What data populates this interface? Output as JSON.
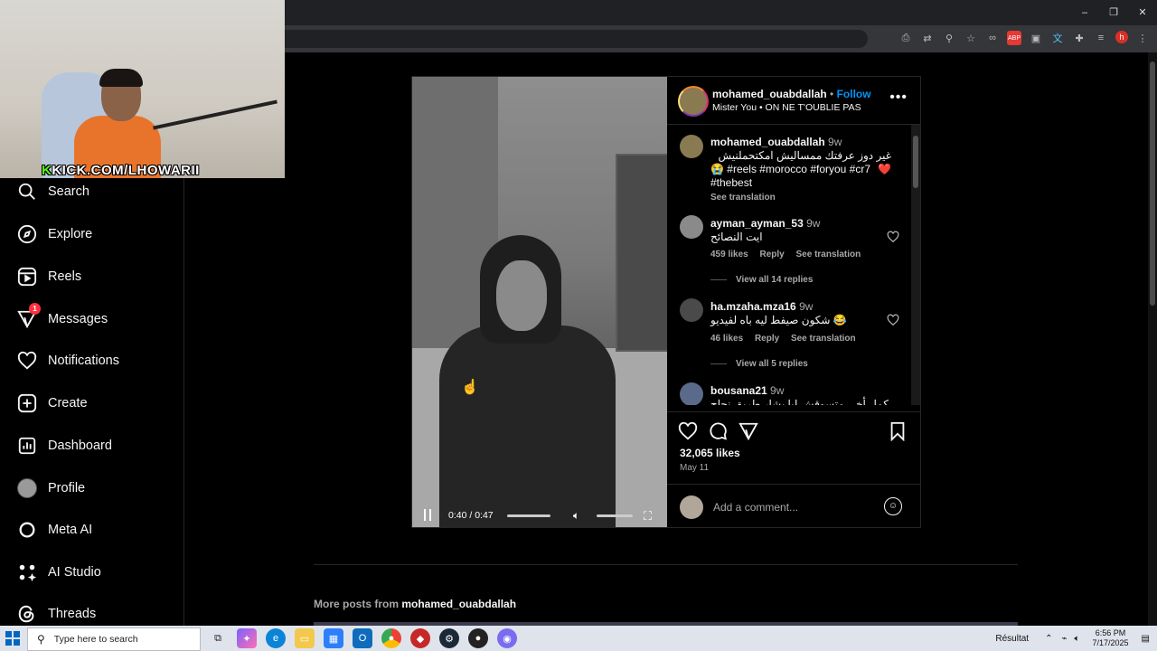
{
  "window": {
    "minimize": "–",
    "restore": "❐",
    "close": "✕"
  },
  "toolbar": {
    "profile_initial": "h"
  },
  "webcam": {
    "overlay_brand": "K",
    "overlay_text": "KICK.COM/LHOWARII"
  },
  "sidebar": {
    "items": [
      {
        "label": "Search"
      },
      {
        "label": "Explore"
      },
      {
        "label": "Reels"
      },
      {
        "label": "Messages",
        "badge": "1"
      },
      {
        "label": "Notifications"
      },
      {
        "label": "Create"
      },
      {
        "label": "Dashboard"
      },
      {
        "label": "Profile"
      },
      {
        "label": "Meta AI"
      },
      {
        "label": "AI Studio"
      },
      {
        "label": "Threads"
      }
    ]
  },
  "post": {
    "username": "mohamed_ouabdallah",
    "follow": "Follow",
    "audio": "Mister You • ON NE T'OUBLIE PAS",
    "video": {
      "time": "0:40 / 0:47",
      "progress": 0.85
    },
    "caption": {
      "user": "mohamed_ouabdallah",
      "ago": "9w",
      "text_ar": "غير دوز عرفتك ممساليش امكتحملنيش ❤️",
      "tags_line1": "😭 #reels #morocco #foryou #cr7",
      "tags_line2": "#thebest",
      "see_translation": "See translation"
    },
    "comments": [
      {
        "user": "ayman_ayman_53",
        "ago": "9w",
        "text": "ايت النصائح",
        "likes": "459 likes",
        "reply": "Reply",
        "translate": "See translation",
        "replies": "View all 14 replies"
      },
      {
        "user": "ha.mzaha.mza16",
        "ago": "9w",
        "text": "شكون صيفط ليه باه لفيديو 😂",
        "likes": "46 likes",
        "reply": "Reply",
        "translate": "See translation",
        "replies": "View all 5 replies"
      },
      {
        "user": "bousana21",
        "ago": "9w",
        "text": "كمل أخي متسوقش ليا بشار طريق نجاح"
      }
    ],
    "likes": "32,065 likes",
    "date": "May 11",
    "add_comment_placeholder": "Add a comment..."
  },
  "more_posts": {
    "prefix": "More posts from ",
    "user": "mohamed_ouabdallah"
  },
  "taskbar": {
    "search_placeholder": "Type here to search",
    "weather": "Résultat",
    "time": "6:56 PM",
    "date": "7/17/2025"
  }
}
